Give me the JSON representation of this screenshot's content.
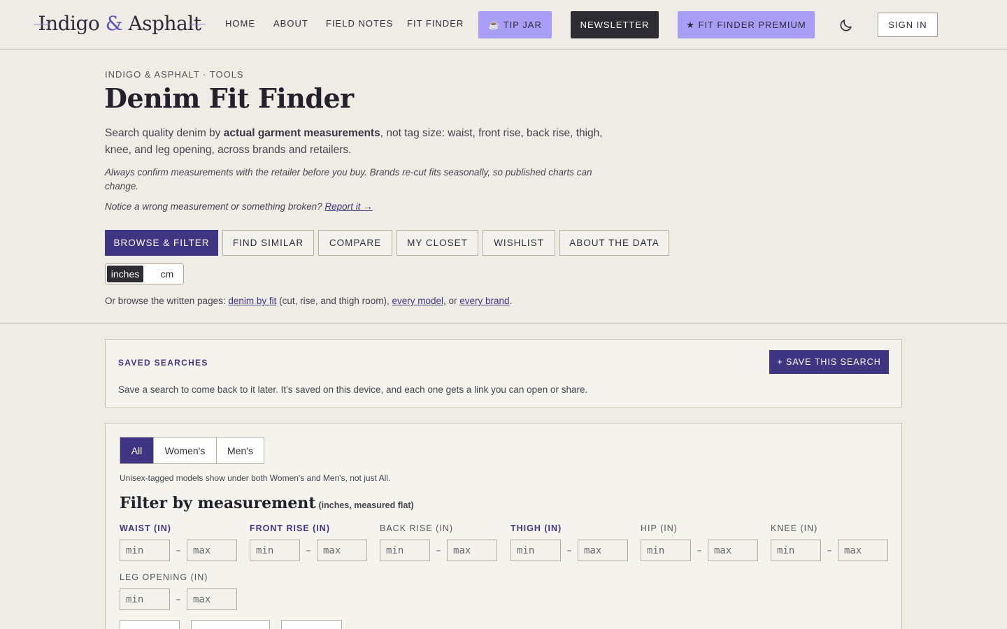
{
  "site": {
    "logo_word1": "Indigo",
    "logo_amp": "&",
    "logo_word2": "Asphalt"
  },
  "nav": {
    "links": [
      "HOME",
      "ABOUT",
      "FIELD NOTES",
      "FIT FINDER"
    ],
    "tip_jar": "☕ TIP JAR",
    "newsletter": "NEWSLETTER",
    "premium": "★ FIT FINDER PREMIUM",
    "sign_in": "SIGN IN",
    "theme_icon": "moon-icon"
  },
  "hero": {
    "eyebrow": "INDIGO & ASPHALT · TOOLS",
    "title": "Denim Fit Finder",
    "intro_pre": "Search quality denim by ",
    "intro_bold": "actual garment measurements",
    "intro_post": ", not tag size: waist, front rise, back rise, thigh, knee, and leg opening, across brands and retailers.",
    "disclaimer": "Always confirm measurements with the retailer before you buy. Brands re-cut fits seasonally, so published charts can change.",
    "report_pre": "Notice a wrong measurement or something broken? ",
    "report_link": "Report it →"
  },
  "tabs": [
    "BROWSE & FILTER",
    "FIND SIMILAR",
    "COMPARE",
    "MY CLOSET",
    "WISHLIST",
    "ABOUT THE DATA"
  ],
  "active_tab": "BROWSE & FILTER",
  "units": {
    "inches": "inches",
    "cm": "cm",
    "selected": "inches"
  },
  "browse": {
    "pre": "Or browse the written pages: ",
    "link1": "denim by fit",
    "mid1": " (cut, rise, and thigh room), ",
    "link2": "every model",
    "mid2": ", or ",
    "link3": "every brand",
    "post": "."
  },
  "saved_searches": {
    "title": "SAVED SEARCHES",
    "save_button": "+ SAVE THIS SEARCH",
    "description": "Save a search to come back to it later. It's saved on this device, and each one gets a link you can open or share."
  },
  "filter": {
    "segments": [
      "All",
      "Women's",
      "Men's"
    ],
    "selected_segment": "All",
    "segment_note": "Unisex-tagged models show under both Women's and Men's, not just All.",
    "title": "Filter by measurement",
    "subtitle": "(inches, measured flat)",
    "min_placeholder": "min",
    "max_placeholder": "max",
    "dash": "–",
    "fields": [
      {
        "label": "WAIST (IN)",
        "highlight": true
      },
      {
        "label": "FRONT RISE (IN)",
        "highlight": true
      },
      {
        "label": "BACK RISE (IN)",
        "highlight": false
      },
      {
        "label": "THIGH (IN)",
        "highlight": true
      },
      {
        "label": "HIP (IN)",
        "highlight": false
      },
      {
        "label": "KNEE (IN)",
        "highlight": false
      },
      {
        "label": "LEG OPENING (IN)",
        "highlight": false
      }
    ]
  },
  "colors": {
    "accent": "#3f3582",
    "accent_light": "#a99df6",
    "dark": "#2d2c33",
    "background": "#efece5"
  }
}
